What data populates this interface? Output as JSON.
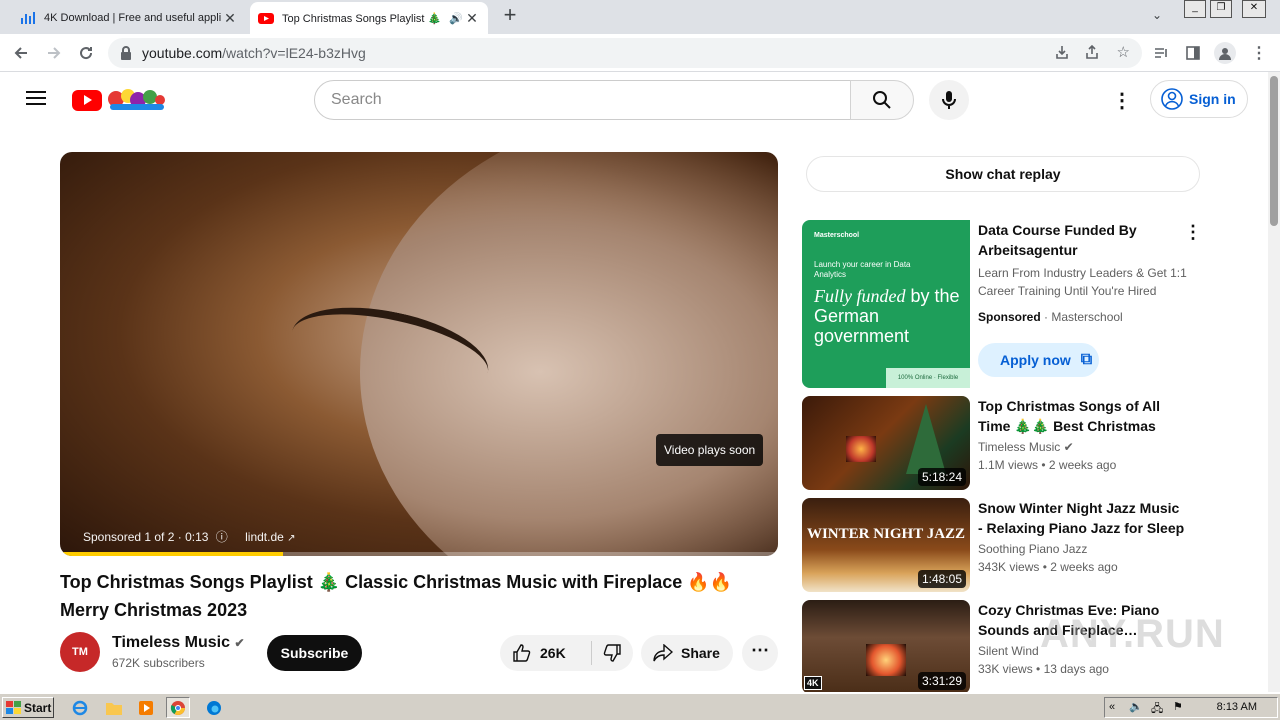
{
  "browser": {
    "tabs": [
      {
        "title": "4K Download | Free and useful appli",
        "icon": "4k-download-icon"
      },
      {
        "title": "Top Christmas Songs Playlist 🎄",
        "icon": "youtube-favicon",
        "active": true
      }
    ],
    "url_host": "youtube.com",
    "url_path": "/watch?v=lE24-b3zHvg"
  },
  "youtube": {
    "search_placeholder": "Search",
    "signin_label": "Sign in"
  },
  "player": {
    "plays_soon": "Video plays soon",
    "ad_label": "Sponsored 1 of 2 · 0:13",
    "ad_link": "lindt.de",
    "progress": 0.31
  },
  "video": {
    "title": "Top Christmas Songs Playlist 🎄 Classic Christmas Music with Fireplace 🔥🔥 Merry Christmas 2023",
    "channel": "Timeless Music",
    "channel_initials": "TM",
    "subscribers": "672K subscribers",
    "subscribe_label": "Subscribe",
    "likes": "26K",
    "share_label": "Share"
  },
  "sidebar": {
    "chat_replay": "Show chat replay",
    "ad": {
      "title": "Data Course Funded By Arbeitsagentur",
      "desc": "Learn From Industry Leaders & Get 1:1 Career Training Until You're Hired",
      "sponsored": "Sponsored",
      "advertiser": "Masterschool",
      "cta": "Apply now",
      "thumb_brand": "Masterschool",
      "thumb_line1": "Launch your career in Data Analytics",
      "thumb_italic": "Fully funded",
      "thumb_rest": "by the German government",
      "thumb_footer": "100% Online · Flexible"
    },
    "videos": [
      {
        "title": "Top Christmas Songs of All Time 🎄🎄 Best Christmas Musi…",
        "channel": "Timeless Music",
        "views": "1.1M views",
        "age": "2 weeks ago",
        "duration": "5:18:24",
        "verified": true
      },
      {
        "title": "Snow Winter Night Jazz Music - Relaxing Piano Jazz for Sleep …",
        "channel": "Soothing Piano Jazz",
        "views": "343K views",
        "age": "2 weeks ago",
        "duration": "1:48:05",
        "thumb_text": "WINTER NIGHT JAZZ"
      },
      {
        "title": "Cozy Christmas Eve: Piano Sounds and Fireplace…",
        "channel": "Silent Wind",
        "views": "33K views",
        "age": "13 days ago",
        "duration": "3:31:29",
        "badge": "4K"
      }
    ]
  },
  "taskbar": {
    "start_label": "Start",
    "clock": "8:13 AM"
  },
  "watermark": "ANY.RUN"
}
